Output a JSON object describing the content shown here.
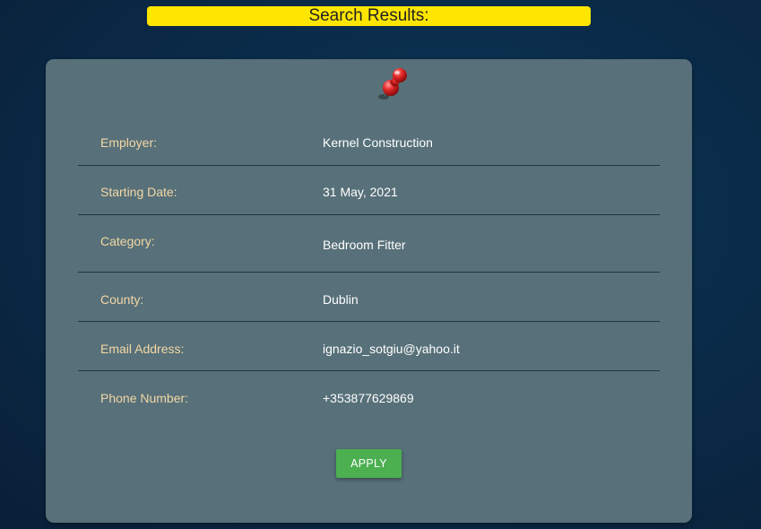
{
  "banner": {
    "title": "Search Results:"
  },
  "card": {
    "pin_icon": "pushpin-icon",
    "fields": [
      {
        "label": "Employer:",
        "value": "Kernel Construction"
      },
      {
        "label": "Starting Date:",
        "value": "31 May, 2021"
      },
      {
        "label": "Category:",
        "value": "Bedroom Fitter"
      },
      {
        "label": "County:",
        "value": "Dublin"
      },
      {
        "label": "Email Address:",
        "value": "ignazio_sotgiu@yahoo.it"
      },
      {
        "label": "Phone Number:",
        "value": "+353877629869"
      }
    ],
    "apply_label": "APPLY"
  },
  "colors": {
    "banner_bg": "#ffe600",
    "card_bg": "#577079",
    "label_text": "#f3d7a6",
    "value_text": "#ffffff",
    "apply_bg": "#4caf50"
  }
}
